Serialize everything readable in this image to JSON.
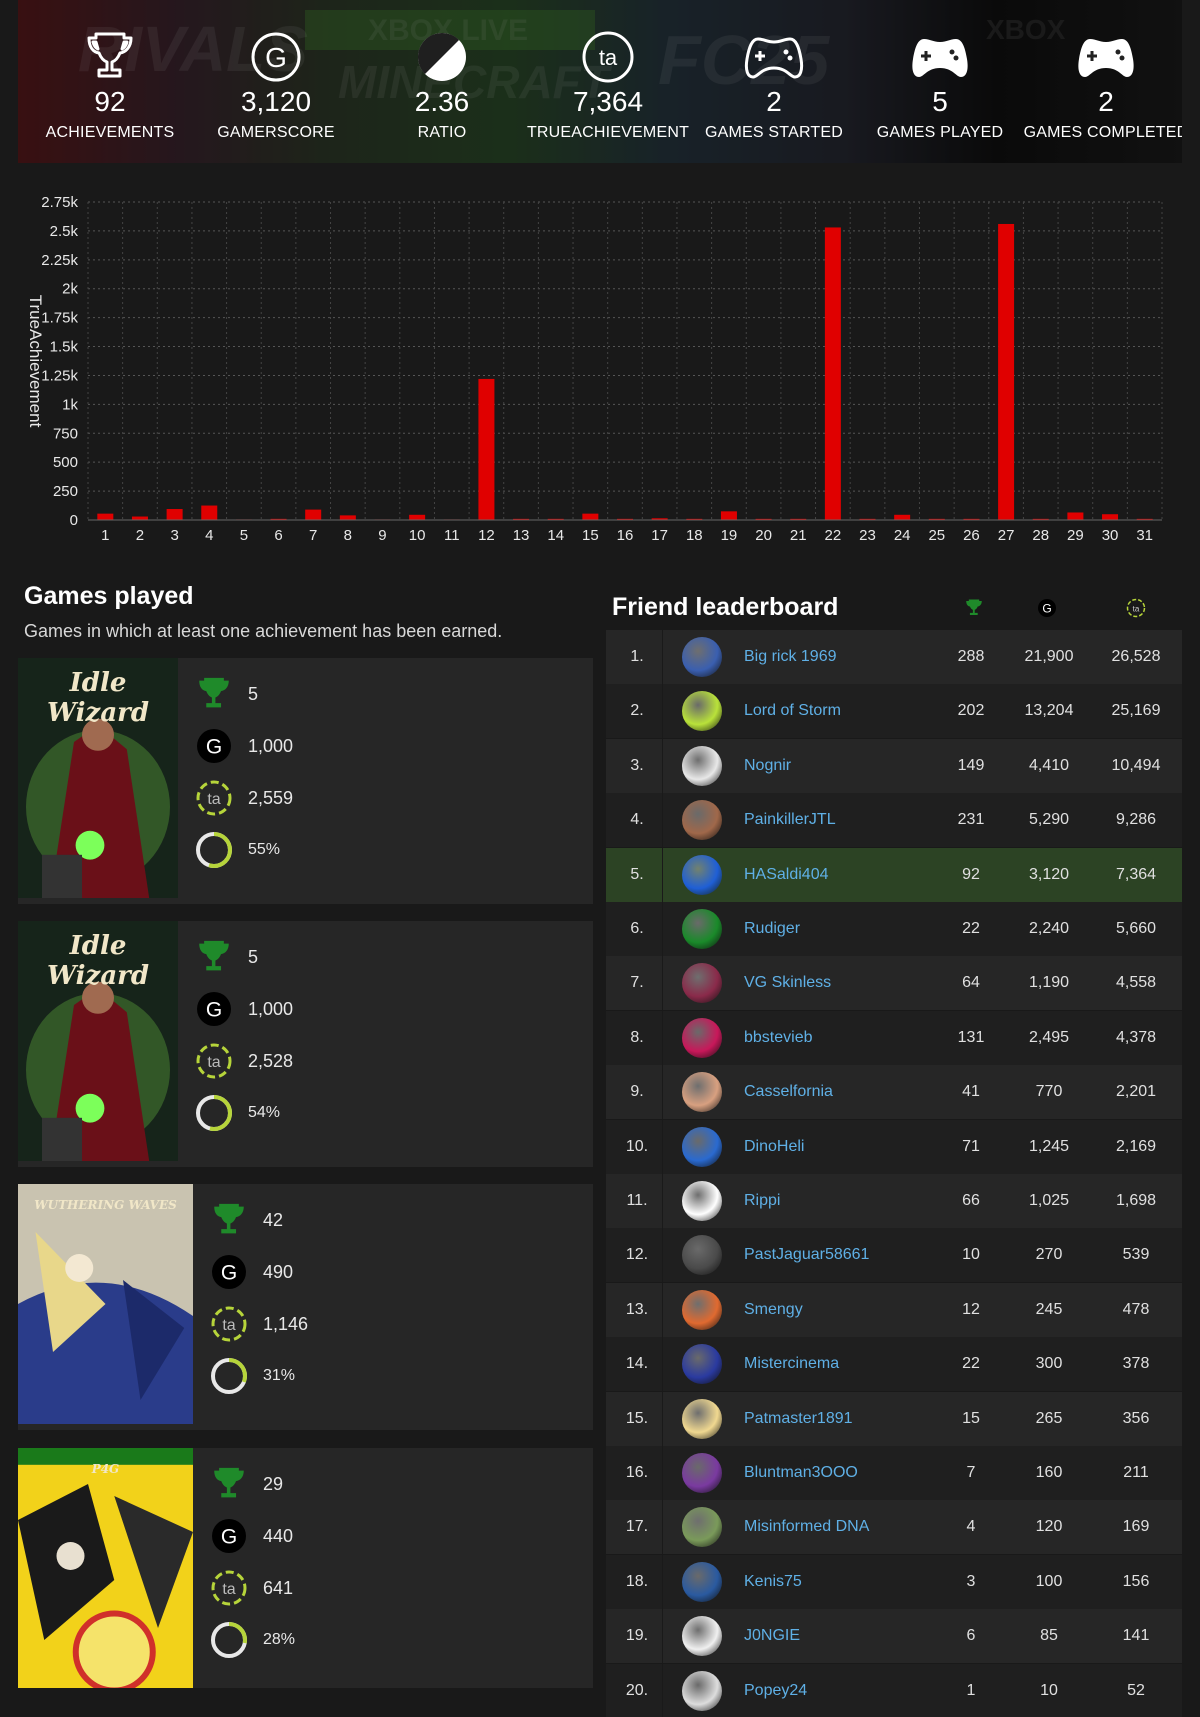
{
  "stats": [
    {
      "icon": "trophy-icon",
      "value": "92",
      "label": "ACHIEVEMENTS"
    },
    {
      "icon": "gamerscore-icon",
      "value": "3,120",
      "label": "GAMERSCORE"
    },
    {
      "icon": "ratio-icon",
      "value": "2.36",
      "label": "RATIO"
    },
    {
      "icon": "trueachievement-icon",
      "value": "7,364",
      "label": "TRUEACHIEVEMENT"
    },
    {
      "icon": "controller-outline-icon",
      "value": "2",
      "label": "GAMES STARTED"
    },
    {
      "icon": "controller-filled-icon",
      "value": "5",
      "label": "GAMES PLAYED"
    },
    {
      "icon": "controller-filled-icon",
      "value": "2",
      "label": "GAMES COMPLETED"
    }
  ],
  "banner_text": [
    "RIVALS",
    "MINECRAFT",
    "XBOX LIVE",
    "FC25",
    "XBOX"
  ],
  "chart_data": {
    "type": "bar",
    "ylabel": "TrueAchievement",
    "categories": [
      "1",
      "2",
      "3",
      "4",
      "5",
      "6",
      "7",
      "8",
      "9",
      "10",
      "11",
      "12",
      "13",
      "14",
      "15",
      "16",
      "17",
      "18",
      "19",
      "20",
      "21",
      "22",
      "23",
      "24",
      "25",
      "26",
      "27",
      "28",
      "29",
      "30",
      "31"
    ],
    "values": [
      55,
      30,
      95,
      125,
      5,
      10,
      90,
      40,
      5,
      45,
      5,
      1220,
      10,
      10,
      55,
      10,
      15,
      10,
      75,
      10,
      10,
      2530,
      10,
      45,
      10,
      10,
      2560,
      10,
      65,
      50,
      10
    ],
    "ylim": [
      0,
      2750
    ],
    "yticks": [
      0,
      250,
      500,
      750,
      1000,
      1250,
      1500,
      1750,
      2000,
      2250,
      2500,
      2750
    ],
    "ytick_labels": [
      "0",
      "250",
      "500",
      "750",
      "1k",
      "1.25k",
      "1.5k",
      "1.75k",
      "2k",
      "2.25k",
      "2.5k",
      "2.75k"
    ],
    "grid": true,
    "bar_color": "#e00000"
  },
  "games_played": {
    "title": "Games played",
    "subtitle": "Games in which at least one achievement has been earned.",
    "games": [
      {
        "art_title": "Idle Wizard",
        "achievements": "5",
        "gamerscore": "1,000",
        "trueachievement": "2,559",
        "completion": "55%",
        "completion_value": 0.55
      },
      {
        "art_title": "Idle Wizard",
        "achievements": "5",
        "gamerscore": "1,000",
        "trueachievement": "2,528",
        "completion": "54%",
        "completion_value": 0.54
      },
      {
        "art_title": "WUTHERING WAVES",
        "achievements": "42",
        "gamerscore": "490",
        "trueachievement": "1,146",
        "completion": "31%",
        "completion_value": 0.31
      },
      {
        "art_title": "P4G",
        "achievements": "29",
        "gamerscore": "440",
        "trueachievement": "641",
        "completion": "28%",
        "completion_value": 0.28
      }
    ]
  },
  "leaderboard": {
    "title": "Friend leaderboard",
    "header_icons": [
      "trophy-icon",
      "gamerscore-icon",
      "trueachievement-icon"
    ],
    "rows": [
      {
        "rank": "1.",
        "name": "Big rick 1969",
        "achievements": "288",
        "gamerscore": "21,900",
        "ta": "26,528",
        "avatar": "#3a5fb0"
      },
      {
        "rank": "2.",
        "name": "Lord of Storm",
        "achievements": "202",
        "gamerscore": "13,204",
        "ta": "25,169",
        "avatar": "#b9e23a"
      },
      {
        "rank": "3.",
        "name": "Nognir",
        "achievements": "149",
        "gamerscore": "4,410",
        "ta": "10,494",
        "avatar": "#e8e8e8"
      },
      {
        "rank": "4.",
        "name": "PainkillerJTL",
        "achievements": "231",
        "gamerscore": "5,290",
        "ta": "9,286",
        "avatar": "#a0684a"
      },
      {
        "rank": "5.",
        "name": "HASaldi404",
        "achievements": "92",
        "gamerscore": "3,120",
        "ta": "7,364",
        "avatar": "#1f5fd6",
        "me": true
      },
      {
        "rank": "6.",
        "name": "Rudiger",
        "achievements": "22",
        "gamerscore": "2,240",
        "ta": "5,660",
        "avatar": "#1a8a2a"
      },
      {
        "rank": "7.",
        "name": "VG Skinless",
        "achievements": "64",
        "gamerscore": "1,190",
        "ta": "4,558",
        "avatar": "#8a2a4a"
      },
      {
        "rank": "8.",
        "name": "bbstevieb",
        "achievements": "131",
        "gamerscore": "2,495",
        "ta": "4,378",
        "avatar": "#c8185a"
      },
      {
        "rank": "9.",
        "name": "Casselfornia",
        "achievements": "41",
        "gamerscore": "770",
        "ta": "2,201",
        "avatar": "#d8a080"
      },
      {
        "rank": "10.",
        "name": "DinoHeli",
        "achievements": "71",
        "gamerscore": "1,245",
        "ta": "2,169",
        "avatar": "#2a6ad0"
      },
      {
        "rank": "11.",
        "name": "Rippi",
        "achievements": "66",
        "gamerscore": "1,025",
        "ta": "1,698",
        "avatar": "#ffffff"
      },
      {
        "rank": "12.",
        "name": "PastJaguar58661",
        "achievements": "10",
        "gamerscore": "270",
        "ta": "539",
        "avatar": "#4a4a4a"
      },
      {
        "rank": "13.",
        "name": "Smengy",
        "achievements": "12",
        "gamerscore": "245",
        "ta": "478",
        "avatar": "#e06a30"
      },
      {
        "rank": "14.",
        "name": "Mistercinema",
        "achievements": "22",
        "gamerscore": "300",
        "ta": "378",
        "avatar": "#2a3aa0"
      },
      {
        "rank": "15.",
        "name": "Patmaster1891",
        "achievements": "15",
        "gamerscore": "265",
        "ta": "356",
        "avatar": "#f0d890"
      },
      {
        "rank": "16.",
        "name": "Bluntman3OOO",
        "achievements": "7",
        "gamerscore": "160",
        "ta": "211",
        "avatar": "#7a3aa0"
      },
      {
        "rank": "17.",
        "name": "Misinformed DNA",
        "achievements": "4",
        "gamerscore": "120",
        "ta": "169",
        "avatar": "#7a9a5a"
      },
      {
        "rank": "18.",
        "name": "Kenis75",
        "achievements": "3",
        "gamerscore": "100",
        "ta": "156",
        "avatar": "#2a5aa0"
      },
      {
        "rank": "19.",
        "name": "J0NGIE",
        "achievements": "6",
        "gamerscore": "85",
        "ta": "141",
        "avatar": "#f0f0f0"
      },
      {
        "rank": "20.",
        "name": "Popey24",
        "achievements": "1",
        "gamerscore": "10",
        "ta": "52",
        "avatar": "#dddddd"
      }
    ]
  },
  "colors": {
    "accent_green": "#1f8a2a",
    "ring_green": "#b6d43a",
    "link": "#5fb0e6",
    "bar": "#e00000"
  }
}
